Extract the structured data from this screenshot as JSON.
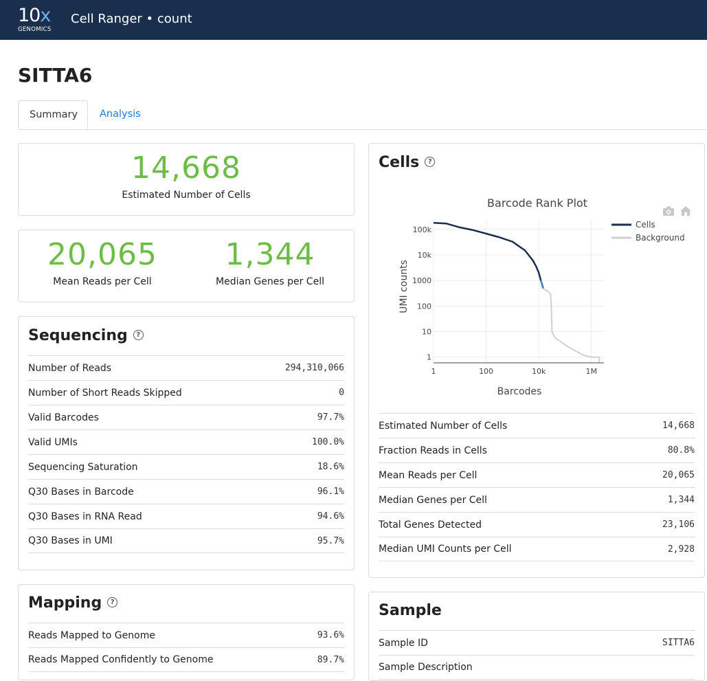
{
  "header": {
    "logo_main": "10",
    "logo_x": "x",
    "logo_sub": "GENOMICS",
    "app_title": "Cell Ranger • count"
  },
  "page_title": "SITTA6",
  "tabs": [
    {
      "label": "Summary",
      "active": true
    },
    {
      "label": "Analysis",
      "active": false
    }
  ],
  "hero": {
    "cells": {
      "value": "14,668",
      "label": "Estimated Number of Cells"
    },
    "reads": {
      "value": "20,065",
      "label": "Mean Reads per Cell"
    },
    "genes": {
      "value": "1,344",
      "label": "Median Genes per Cell"
    }
  },
  "sequencing": {
    "title": "Sequencing",
    "help": "?",
    "rows": [
      {
        "label": "Number of Reads",
        "value": "294,310,066"
      },
      {
        "label": "Number of Short Reads Skipped",
        "value": "0"
      },
      {
        "label": "Valid Barcodes",
        "value": "97.7%"
      },
      {
        "label": "Valid UMIs",
        "value": "100.0%"
      },
      {
        "label": "Sequencing Saturation",
        "value": "18.6%"
      },
      {
        "label": "Q30 Bases in Barcode",
        "value": "96.1%"
      },
      {
        "label": "Q30 Bases in RNA Read",
        "value": "94.6%"
      },
      {
        "label": "Q30 Bases in UMI",
        "value": "95.7%"
      }
    ]
  },
  "mapping": {
    "title": "Mapping",
    "help": "?",
    "rows": [
      {
        "label": "Reads Mapped to Genome",
        "value": "93.6%"
      },
      {
        "label": "Reads Mapped Confidently to Genome",
        "value": "89.7%"
      }
    ]
  },
  "cells": {
    "title": "Cells",
    "help": "?",
    "rows": [
      {
        "label": "Estimated Number of Cells",
        "value": "14,668"
      },
      {
        "label": "Fraction Reads in Cells",
        "value": "80.8%"
      },
      {
        "label": "Mean Reads per Cell",
        "value": "20,065"
      },
      {
        "label": "Median Genes per Cell",
        "value": "1,344"
      },
      {
        "label": "Total Genes Detected",
        "value": "23,106"
      },
      {
        "label": "Median UMI Counts per Cell",
        "value": "2,928"
      }
    ]
  },
  "sample": {
    "title": "Sample",
    "rows": [
      {
        "label": "Sample ID",
        "value": "SITTA6"
      },
      {
        "label": "Sample Description",
        "value": ""
      }
    ]
  },
  "chart_data": {
    "type": "line",
    "title": "Barcode Rank Plot",
    "xlabel": "Barcodes",
    "ylabel": "UMI counts",
    "x_scale": "log",
    "y_scale": "log",
    "xlim": [
      1,
      3000000
    ],
    "ylim": [
      0.6,
      250000
    ],
    "x_ticks": [
      {
        "value": 1,
        "label": "1"
      },
      {
        "value": 100,
        "label": "100"
      },
      {
        "value": 10000,
        "label": "10k"
      },
      {
        "value": 1000000,
        "label": "1M"
      }
    ],
    "y_ticks": [
      {
        "value": 1,
        "label": "1"
      },
      {
        "value": 10,
        "label": "10"
      },
      {
        "value": 100,
        "label": "100"
      },
      {
        "value": 1000,
        "label": "1000"
      },
      {
        "value": 10000,
        "label": "10k"
      },
      {
        "value": 100000,
        "label": "100k"
      }
    ],
    "grid": true,
    "legend_position": "top-right",
    "series": [
      {
        "name": "Cells",
        "color": "#1a2f4e",
        "points": [
          [
            1,
            180000
          ],
          [
            3,
            170000
          ],
          [
            10,
            120000
          ],
          [
            30,
            95000
          ],
          [
            100,
            68000
          ],
          [
            300,
            50000
          ],
          [
            1000,
            33000
          ],
          [
            3000,
            15000
          ],
          [
            6000,
            6000
          ],
          [
            8000,
            3500
          ],
          [
            10000,
            2000
          ],
          [
            12000,
            1000
          ],
          [
            14668,
            500
          ]
        ]
      },
      {
        "name": "",
        "color": "#4a90d9",
        "points": [
          [
            12000,
            1000
          ],
          [
            13000,
            700
          ],
          [
            14668,
            480
          ]
        ]
      },
      {
        "name": "Background",
        "color": "#d0d0d0",
        "points": [
          [
            14668,
            480
          ],
          [
            22000,
            380
          ],
          [
            26000,
            330
          ],
          [
            28000,
            300
          ],
          [
            30000,
            100
          ],
          [
            32000,
            10
          ],
          [
            40000,
            6
          ],
          [
            50000,
            5
          ],
          [
            70000,
            4
          ],
          [
            100000,
            3
          ],
          [
            200000,
            2
          ],
          [
            500000,
            1.2
          ],
          [
            1000000,
            1
          ],
          [
            2000000,
            1
          ],
          [
            2000000,
            0.6
          ]
        ]
      }
    ]
  },
  "chart_icons": {
    "camera": "camera-icon",
    "home": "home-icon"
  },
  "colors": {
    "header_bg": "#1a2f4e",
    "accent_green": "#6bbd45",
    "link_blue": "#1a7be0"
  }
}
